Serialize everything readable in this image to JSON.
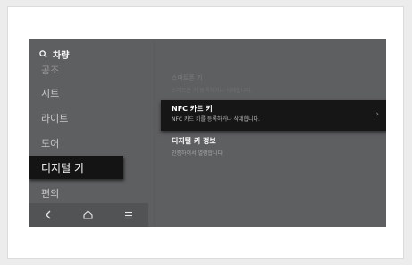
{
  "search": {
    "icon": "search-icon",
    "label": "차량"
  },
  "sidebar": {
    "items": [
      {
        "label": "공조"
      },
      {
        "label": "시트"
      },
      {
        "label": "라이트"
      },
      {
        "label": "도어"
      },
      {
        "label": "디지털 키"
      },
      {
        "label": "편의"
      }
    ],
    "selected": "디지털 키"
  },
  "navbar": {
    "back_icon": "chevron-left-icon",
    "home_icon": "home-icon",
    "menu_icon": "menu-icon"
  },
  "panel": {
    "ghost_title": "스마트폰 키",
    "ghost_sub": "스마트폰 키 등록하거나 삭제합니다.",
    "card_title": "NFC 카드 키",
    "card_sub": "NFC 카드 키를 등록하거나 삭제합니다.",
    "card_chevron": "›",
    "info_title": "디지털 키 정보",
    "info_sub": "인증하여서 열람합니다"
  },
  "colors": {
    "screen_bg": "#5e5f61",
    "selected_bg": "#141414",
    "card_bg": "#161616"
  }
}
